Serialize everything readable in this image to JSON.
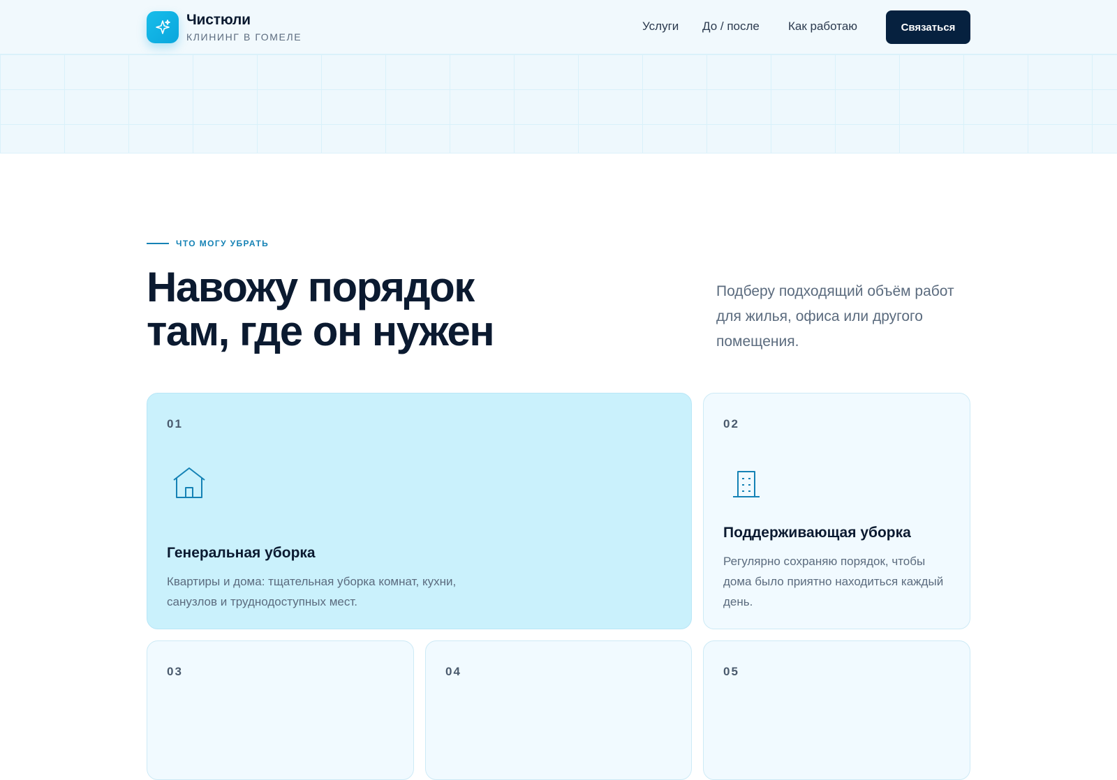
{
  "header": {
    "brand_name": "Чистюли",
    "brand_subtitle": "КЛИНИНГ В ГОМЕЛЕ",
    "logo_icon": "sparkle-icon",
    "nav": [
      {
        "label": "Услуги"
      },
      {
        "label": "До / после"
      },
      {
        "label": "Как работаю"
      }
    ],
    "cta_label": "Связаться"
  },
  "services": {
    "eyebrow": "ЧТО МОГУ УБРАТЬ",
    "headline_line1": "Навожу порядок",
    "headline_line2": "там, где он нужен",
    "lead": "Подберу подходящий объём работ для жилья, офиса или другого помещения.",
    "cards": [
      {
        "number": "01",
        "icon": "house-icon",
        "title": "Генеральная уборка",
        "text": "Квартиры и дома: тщательная уборка комнат, кухни, санузлов и труднодоступных мест."
      },
      {
        "number": "02",
        "icon": "building-icon",
        "title": "Поддерживающая уборка",
        "text": "Регулярно сохраняю порядок, чтобы дома было приятно находиться каждый день."
      },
      {
        "number": "03"
      },
      {
        "number": "04"
      },
      {
        "number": "05"
      }
    ]
  },
  "colors": {
    "accent": "#17bdea",
    "primary_dark": "#06213f",
    "eyebrow_blue": "#1582b5",
    "featured_card": "#caf1fc",
    "card_bg": "#f1faff"
  }
}
